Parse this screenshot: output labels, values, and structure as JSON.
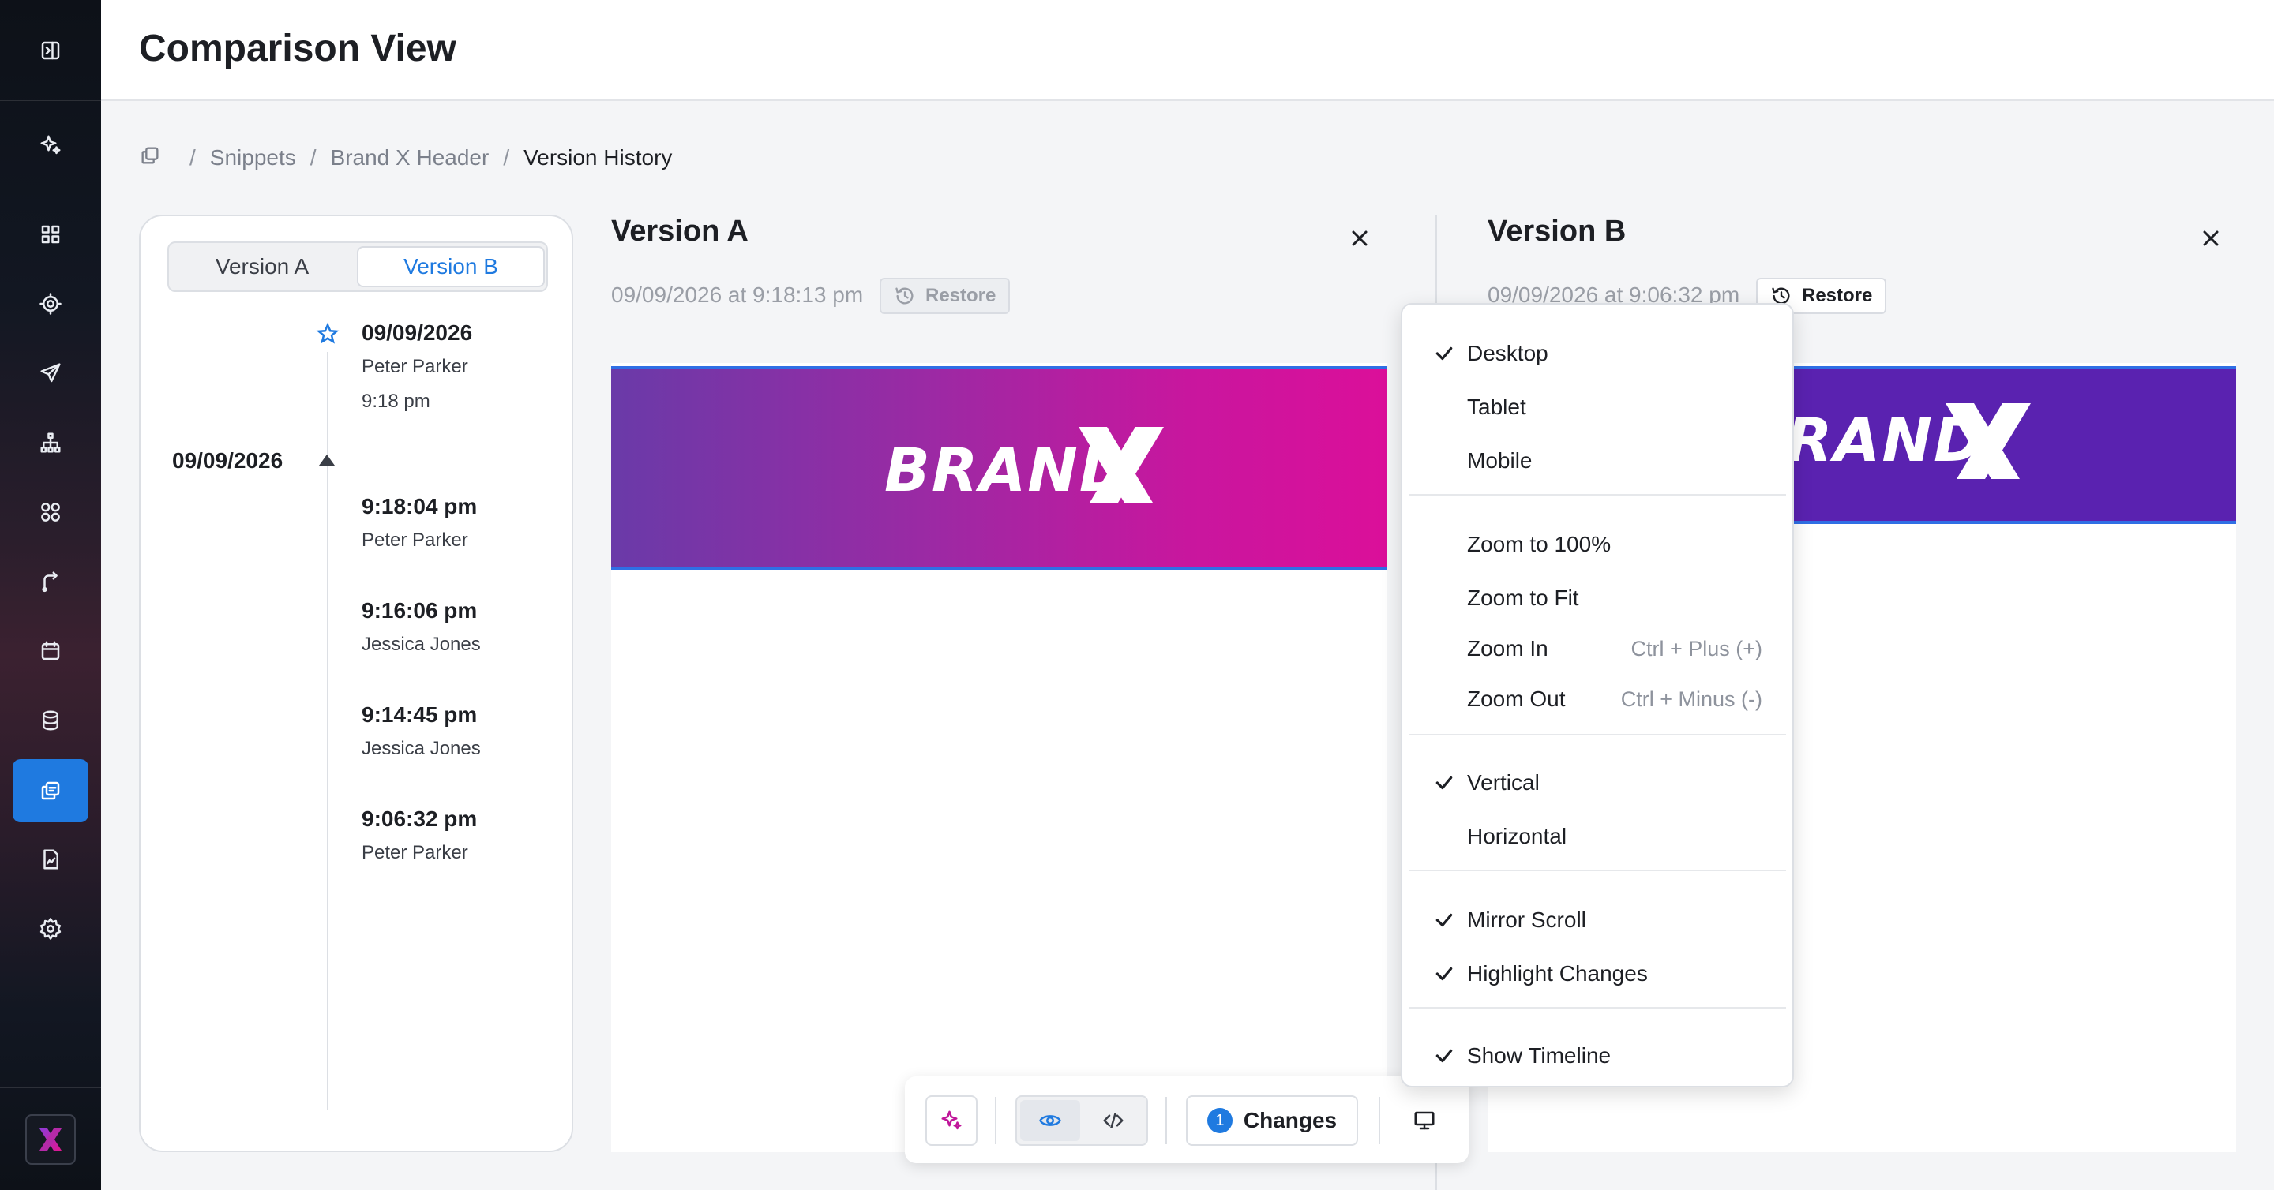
{
  "header": {
    "title": "Comparison View"
  },
  "breadcrumb": {
    "items": [
      "Snippets",
      "Brand X Header"
    ],
    "current": "Version History",
    "separator": "/"
  },
  "timeline": {
    "tabs": {
      "a": "Version A",
      "b": "Version B"
    },
    "active_tab": "Version B",
    "top_entry": {
      "date": "09/09/2026",
      "user": "Peter Parker",
      "time": "9:18 pm"
    },
    "group_date": "09/09/2026",
    "entries": [
      {
        "time": "9:18:04 pm",
        "user": "Peter Parker"
      },
      {
        "time": "9:16:06 pm",
        "user": "Jessica Jones"
      },
      {
        "time": "9:14:45 pm",
        "user": "Jessica Jones"
      },
      {
        "time": "9:06:32 pm",
        "user": "Peter Parker"
      }
    ]
  },
  "version_a": {
    "title": "Version A",
    "timestamp": "09/09/2026 at 9:18:13 pm",
    "restore_label": "Restore",
    "banner_text": "BRAND"
  },
  "version_b": {
    "title": "Version B",
    "timestamp": "09/09/2026 at 9:06:32 pm",
    "restore_label": "Restore",
    "banner_text": "RAND"
  },
  "toolbar": {
    "changes_count": "1",
    "changes_label": "Changes"
  },
  "menu": {
    "desktop": "Desktop",
    "tablet": "Tablet",
    "mobile": "Mobile",
    "zoom_100": "Zoom to 100%",
    "zoom_fit": "Zoom to Fit",
    "zoom_in": "Zoom In",
    "zoom_in_shortcut": "Ctrl + Plus (+)",
    "zoom_out": "Zoom Out",
    "zoom_out_shortcut": "Ctrl + Minus (-)",
    "vertical": "Vertical",
    "horizontal": "Horizontal",
    "mirror_scroll": "Mirror Scroll",
    "highlight_changes": "Highlight Changes",
    "show_timeline": "Show Timeline",
    "checked": [
      "Desktop",
      "Vertical",
      "Mirror Scroll",
      "Highlight Changes",
      "Show Timeline"
    ]
  },
  "colors": {
    "accent": "#1f7ae0",
    "banner_a_start": "#6a3aa8",
    "banner_a_end": "#db0f9a",
    "banner_b": "#5a22b0",
    "sidebar_active": "#1f7ae0"
  },
  "sidebar": {
    "icons": [
      "panel-toggle-icon",
      "sparkle-icon",
      "grid-icon",
      "target-icon",
      "send-icon",
      "sitemap-icon",
      "components-icon",
      "flow-icon",
      "calendar-icon",
      "database-icon",
      "snippets-icon",
      "report-icon",
      "settings-icon"
    ],
    "active": "snippets-icon"
  }
}
